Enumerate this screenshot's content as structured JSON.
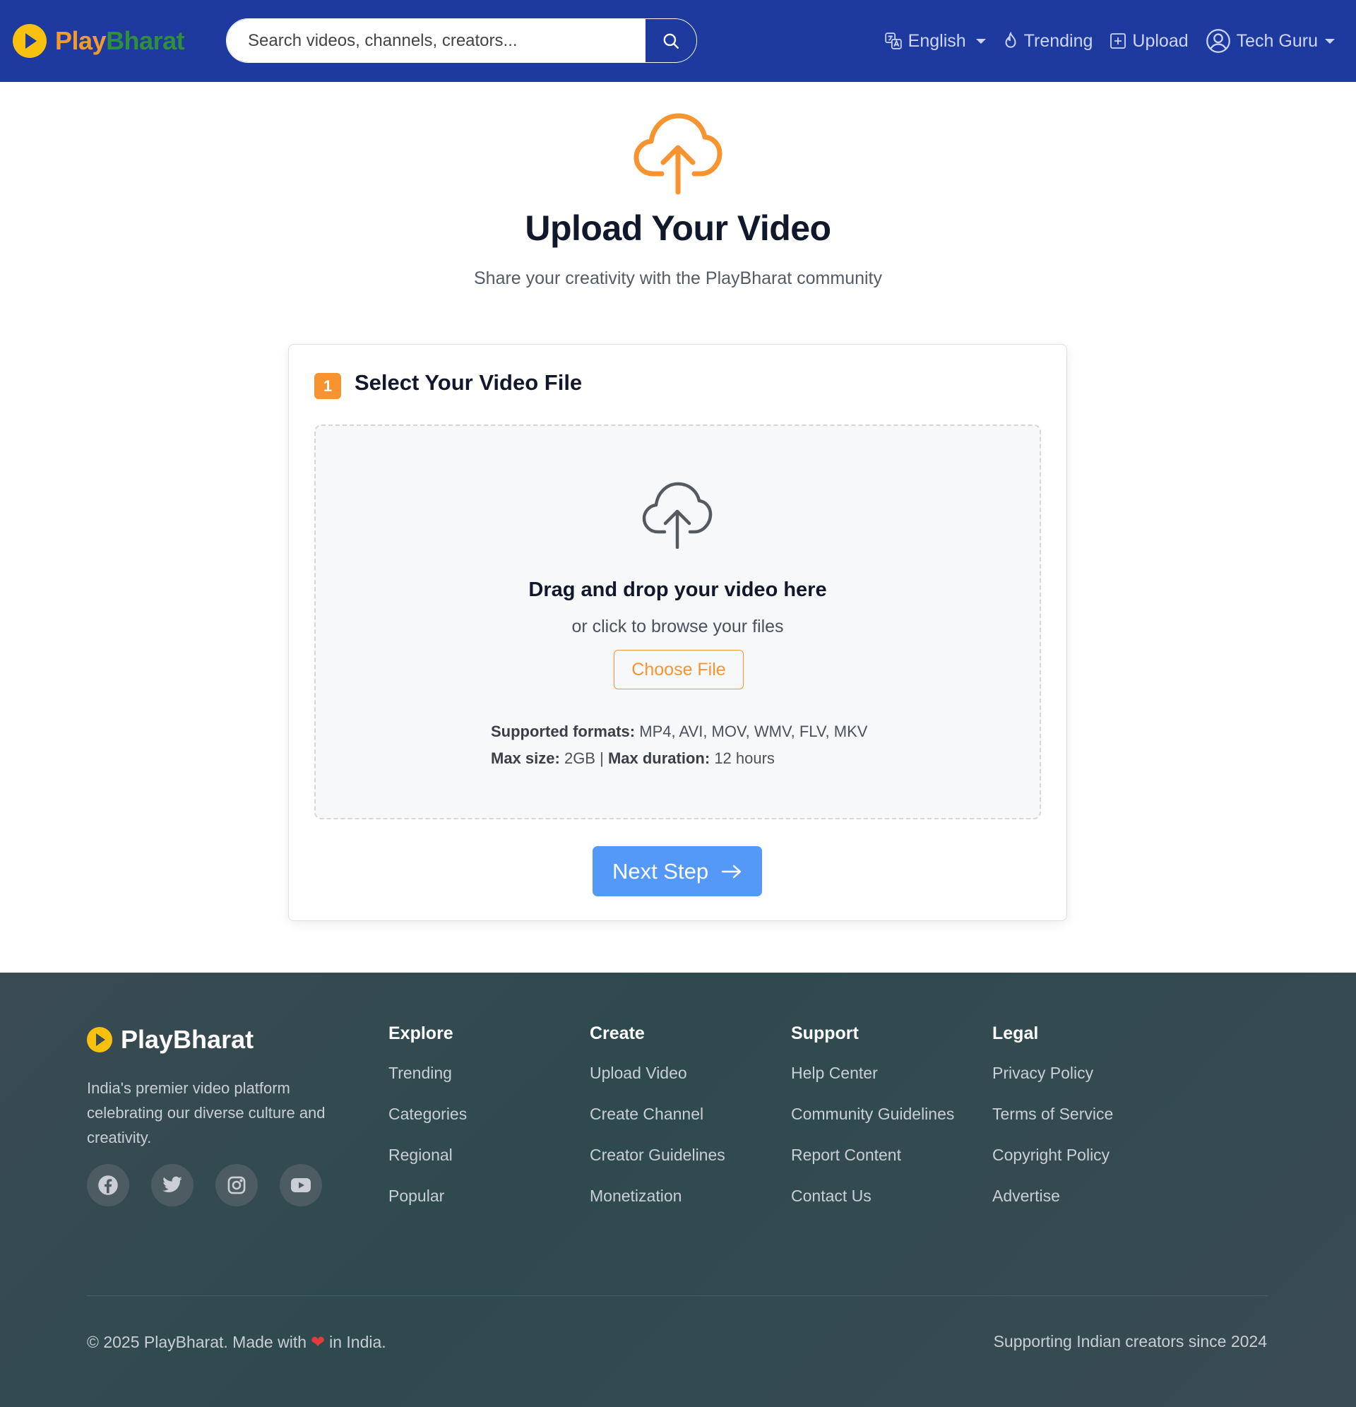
{
  "header": {
    "brand_part1": "Play",
    "brand_part2": "Bharat",
    "search_placeholder": "Search videos, channels, creators...",
    "language": "English",
    "trending": "Trending",
    "upload": "Upload",
    "user": "Tech Guru"
  },
  "hero": {
    "title": "Upload Your Video",
    "subtitle": "Share your creativity with the PlayBharat community"
  },
  "step": {
    "number": "1",
    "title": "Select Your Video File"
  },
  "dropzone": {
    "title": "Drag and drop your video here",
    "subtitle": "or click to browse your files",
    "choose_label": "Choose File",
    "formats_label": "Supported formats:",
    "formats_value": "MP4, AVI, MOV, WMV, FLV, MKV",
    "maxsize_label": "Max size:",
    "maxsize_value": "2GB",
    "separator": "|",
    "maxduration_label": "Max duration:",
    "maxduration_value": "12 hours"
  },
  "next_label": "Next Step",
  "footer": {
    "brand": "PlayBharat",
    "description": "India's premier video platform celebrating our diverse culture and creativity.",
    "columns": [
      {
        "title": "Explore",
        "links": [
          "Trending",
          "Categories",
          "Regional",
          "Popular"
        ]
      },
      {
        "title": "Create",
        "links": [
          "Upload Video",
          "Create Channel",
          "Creator Guidelines",
          "Monetization"
        ]
      },
      {
        "title": "Support",
        "links": [
          "Help Center",
          "Community Guidelines",
          "Report Content",
          "Contact Us"
        ]
      },
      {
        "title": "Legal",
        "links": [
          "Privacy Policy",
          "Terms of Service",
          "Copyright Policy",
          "Advertise"
        ]
      }
    ],
    "copyright_pre": "© 2025 PlayBharat. Made with",
    "copyright_post": "in India.",
    "tagline": "Supporting Indian creators since 2024"
  },
  "colors": {
    "header_bg": "#1e3a9e",
    "accent_orange": "#f7942f",
    "primary_blue": "#5499f7"
  }
}
